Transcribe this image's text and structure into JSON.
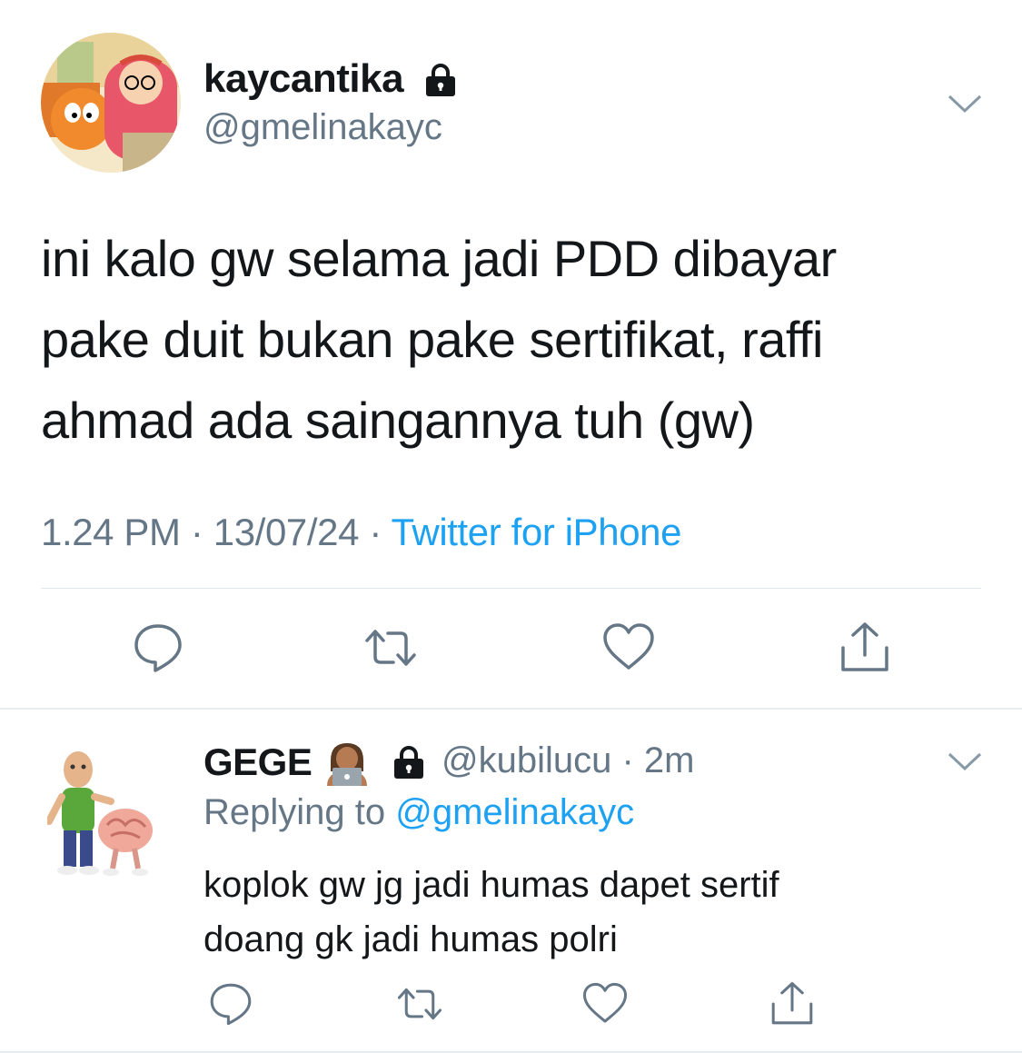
{
  "tweet": {
    "display_name": "kaycantika",
    "handle": "@gmelinakayc",
    "text": "ini kalo gw selama jadi PDD dibayar\npake duit bukan pake sertifikat, raffi\nahmad ada saingannya tuh (gw)",
    "time": "1.24 PM",
    "date": "13/07/24",
    "separator": "·",
    "source": "Twitter for iPhone",
    "icons": [
      "lock-icon",
      "chevron-down-icon",
      "reply-icon",
      "retweet-icon",
      "like-icon",
      "share-icon"
    ]
  },
  "reply": {
    "display_name": "GEGE",
    "emoji": "👩🏽‍💻",
    "handle_time": "@kubilucu · 2m",
    "replying_prefix": "Replying to",
    "replying_to": "@gmelinakayc",
    "text": "koplok gw jg jadi humas dapet sertif\ndoang gk jadi humas polri",
    "icons": [
      "lock-icon",
      "chevron-down-icon",
      "reply-icon",
      "retweet-icon",
      "like-icon",
      "share-icon"
    ]
  },
  "colors": {
    "text": "#14171a",
    "secondary": "#657786",
    "link": "#1da1f2",
    "divider": "#e1e8ed"
  }
}
